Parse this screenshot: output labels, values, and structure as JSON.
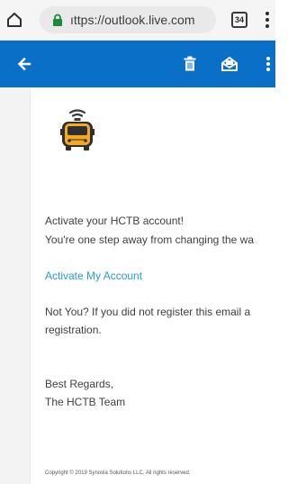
{
  "browser": {
    "tab_count": "34",
    "url_display": "ıttps://outlook.live.com"
  },
  "app_bar": {
    "background_color": "#0a6fc6",
    "back_icon": "back-arrow-icon",
    "delete_icon": "trash-icon",
    "read_icon": "mark-read-icon",
    "more_icon": "more-vertical-icon"
  },
  "email": {
    "logo_icon": "school-bus-wifi-icon",
    "heading": "Activate your HCTB account!",
    "line1": "You're one step away from changing the wa",
    "activate_link": "Activate My Account",
    "not_you_line": "Not You? If you did not register this email a",
    "registration_line": "registration.",
    "regards": "Best Regards,",
    "team": "The HCTB Team",
    "copyright": "Copyright © 2019 Synovia Solutions LLC, All rights reserved."
  }
}
